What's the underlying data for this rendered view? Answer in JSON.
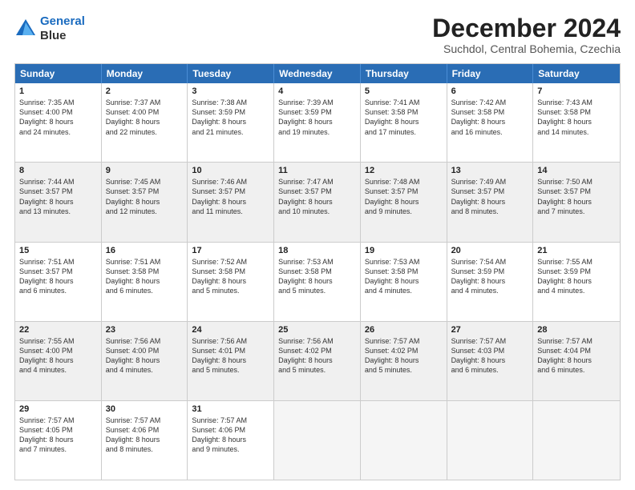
{
  "logo": {
    "line1": "General",
    "line2": "Blue"
  },
  "title": "December 2024",
  "subtitle": "Suchdol, Central Bohemia, Czechia",
  "header_days": [
    "Sunday",
    "Monday",
    "Tuesday",
    "Wednesday",
    "Thursday",
    "Friday",
    "Saturday"
  ],
  "weeks": [
    [
      {
        "day": "1",
        "text": "Sunrise: 7:35 AM\nSunset: 4:00 PM\nDaylight: 8 hours\nand 24 minutes."
      },
      {
        "day": "2",
        "text": "Sunrise: 7:37 AM\nSunset: 4:00 PM\nDaylight: 8 hours\nand 22 minutes."
      },
      {
        "day": "3",
        "text": "Sunrise: 7:38 AM\nSunset: 3:59 PM\nDaylight: 8 hours\nand 21 minutes."
      },
      {
        "day": "4",
        "text": "Sunrise: 7:39 AM\nSunset: 3:59 PM\nDaylight: 8 hours\nand 19 minutes."
      },
      {
        "day": "5",
        "text": "Sunrise: 7:41 AM\nSunset: 3:58 PM\nDaylight: 8 hours\nand 17 minutes."
      },
      {
        "day": "6",
        "text": "Sunrise: 7:42 AM\nSunset: 3:58 PM\nDaylight: 8 hours\nand 16 minutes."
      },
      {
        "day": "7",
        "text": "Sunrise: 7:43 AM\nSunset: 3:58 PM\nDaylight: 8 hours\nand 14 minutes."
      }
    ],
    [
      {
        "day": "8",
        "text": "Sunrise: 7:44 AM\nSunset: 3:57 PM\nDaylight: 8 hours\nand 13 minutes.",
        "shaded": true
      },
      {
        "day": "9",
        "text": "Sunrise: 7:45 AM\nSunset: 3:57 PM\nDaylight: 8 hours\nand 12 minutes.",
        "shaded": true
      },
      {
        "day": "10",
        "text": "Sunrise: 7:46 AM\nSunset: 3:57 PM\nDaylight: 8 hours\nand 11 minutes.",
        "shaded": true
      },
      {
        "day": "11",
        "text": "Sunrise: 7:47 AM\nSunset: 3:57 PM\nDaylight: 8 hours\nand 10 minutes.",
        "shaded": true
      },
      {
        "day": "12",
        "text": "Sunrise: 7:48 AM\nSunset: 3:57 PM\nDaylight: 8 hours\nand 9 minutes.",
        "shaded": true
      },
      {
        "day": "13",
        "text": "Sunrise: 7:49 AM\nSunset: 3:57 PM\nDaylight: 8 hours\nand 8 minutes.",
        "shaded": true
      },
      {
        "day": "14",
        "text": "Sunrise: 7:50 AM\nSunset: 3:57 PM\nDaylight: 8 hours\nand 7 minutes.",
        "shaded": true
      }
    ],
    [
      {
        "day": "15",
        "text": "Sunrise: 7:51 AM\nSunset: 3:57 PM\nDaylight: 8 hours\nand 6 minutes."
      },
      {
        "day": "16",
        "text": "Sunrise: 7:51 AM\nSunset: 3:58 PM\nDaylight: 8 hours\nand 6 minutes."
      },
      {
        "day": "17",
        "text": "Sunrise: 7:52 AM\nSunset: 3:58 PM\nDaylight: 8 hours\nand 5 minutes."
      },
      {
        "day": "18",
        "text": "Sunrise: 7:53 AM\nSunset: 3:58 PM\nDaylight: 8 hours\nand 5 minutes."
      },
      {
        "day": "19",
        "text": "Sunrise: 7:53 AM\nSunset: 3:58 PM\nDaylight: 8 hours\nand 4 minutes."
      },
      {
        "day": "20",
        "text": "Sunrise: 7:54 AM\nSunset: 3:59 PM\nDaylight: 8 hours\nand 4 minutes."
      },
      {
        "day": "21",
        "text": "Sunrise: 7:55 AM\nSunset: 3:59 PM\nDaylight: 8 hours\nand 4 minutes."
      }
    ],
    [
      {
        "day": "22",
        "text": "Sunrise: 7:55 AM\nSunset: 4:00 PM\nDaylight: 8 hours\nand 4 minutes.",
        "shaded": true
      },
      {
        "day": "23",
        "text": "Sunrise: 7:56 AM\nSunset: 4:00 PM\nDaylight: 8 hours\nand 4 minutes.",
        "shaded": true
      },
      {
        "day": "24",
        "text": "Sunrise: 7:56 AM\nSunset: 4:01 PM\nDaylight: 8 hours\nand 5 minutes.",
        "shaded": true
      },
      {
        "day": "25",
        "text": "Sunrise: 7:56 AM\nSunset: 4:02 PM\nDaylight: 8 hours\nand 5 minutes.",
        "shaded": true
      },
      {
        "day": "26",
        "text": "Sunrise: 7:57 AM\nSunset: 4:02 PM\nDaylight: 8 hours\nand 5 minutes.",
        "shaded": true
      },
      {
        "day": "27",
        "text": "Sunrise: 7:57 AM\nSunset: 4:03 PM\nDaylight: 8 hours\nand 6 minutes.",
        "shaded": true
      },
      {
        "day": "28",
        "text": "Sunrise: 7:57 AM\nSunset: 4:04 PM\nDaylight: 8 hours\nand 6 minutes.",
        "shaded": true
      }
    ],
    [
      {
        "day": "29",
        "text": "Sunrise: 7:57 AM\nSunset: 4:05 PM\nDaylight: 8 hours\nand 7 minutes."
      },
      {
        "day": "30",
        "text": "Sunrise: 7:57 AM\nSunset: 4:06 PM\nDaylight: 8 hours\nand 8 minutes."
      },
      {
        "day": "31",
        "text": "Sunrise: 7:57 AM\nSunset: 4:06 PM\nDaylight: 8 hours\nand 9 minutes."
      },
      {
        "day": "",
        "text": "",
        "empty": true
      },
      {
        "day": "",
        "text": "",
        "empty": true
      },
      {
        "day": "",
        "text": "",
        "empty": true
      },
      {
        "day": "",
        "text": "",
        "empty": true
      }
    ]
  ]
}
